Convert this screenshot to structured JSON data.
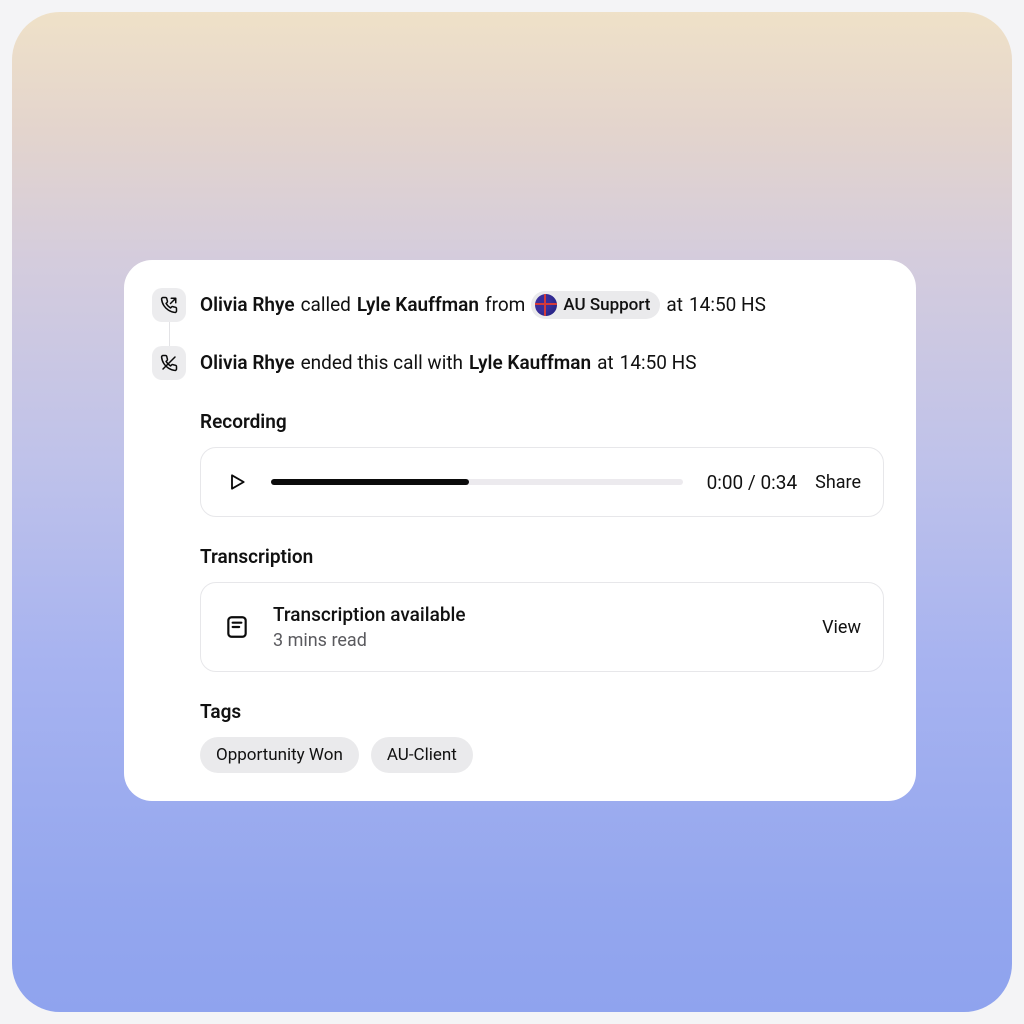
{
  "events": {
    "call_started": {
      "actor": "Olivia Rhye",
      "verb": "called",
      "target": "Lyle Kauffman",
      "from_word": "from",
      "source_label": "AU Support",
      "at_word": "at",
      "time": "14:50 HS"
    },
    "call_ended": {
      "actor": "Olivia Rhye",
      "verb": "ended this call with",
      "target": "Lyle Kauffman",
      "at_word": "at",
      "time": "14:50 HS"
    }
  },
  "recording": {
    "section_title": "Recording",
    "elapsed": "0:00",
    "separator": "/",
    "total": "0:34",
    "share_label": "Share",
    "progress_pct": 48
  },
  "transcription": {
    "section_title": "Transcription",
    "title": "Transcription available",
    "subtitle": "3 mins read",
    "view_label": "View"
  },
  "tags": {
    "section_title": "Tags",
    "items": [
      "Opportunity Won",
      "AU-Client"
    ]
  }
}
